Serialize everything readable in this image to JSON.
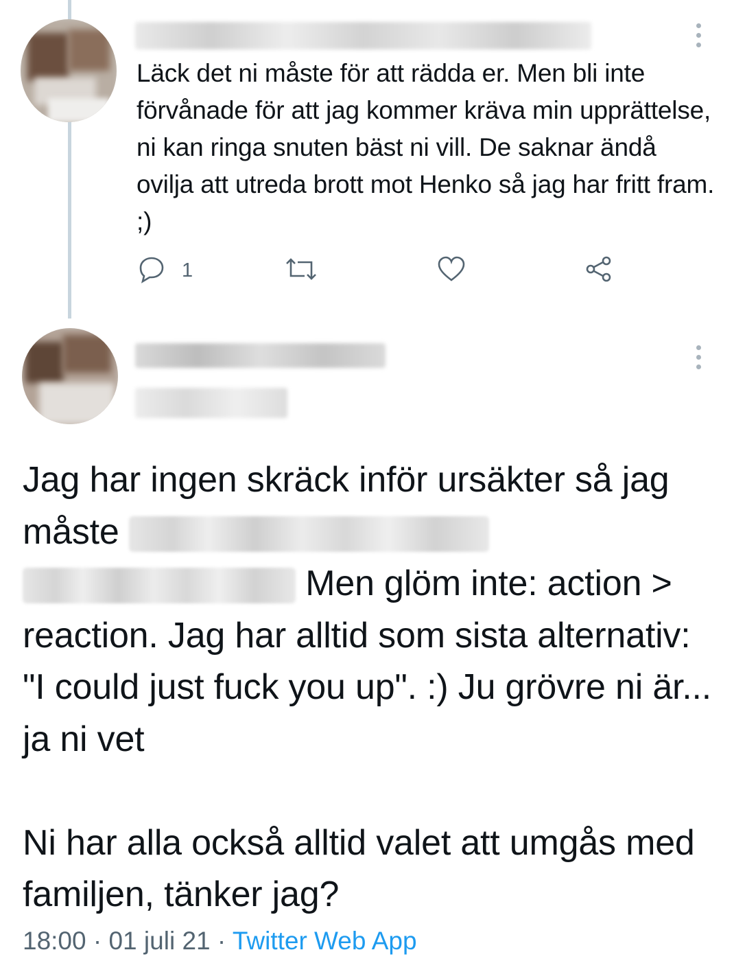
{
  "tweet1": {
    "text": "Läck det ni måste för att rädda er. Men bli inte förvånade för att jag kommer kräva min upprättelse, ni kan ringa snuten bäst ni vill. De saknar ändå ovilja att utreda brott mot Henko så jag har fritt fram. ;)",
    "reply_count": "1",
    "icons": {
      "reply": "reply-icon",
      "retweet": "retweet-icon",
      "like": "heart-icon",
      "share": "share-icon",
      "more": "more-vertical-icon"
    }
  },
  "tweet2": {
    "text_part1": "Jag har ingen skräck inför ursäkter så jag måste ",
    "text_part2": " Men glöm inte: action > reaction. Jag har alltid som sista alternativ: \"I could just fuck you up\". :) Ju grövre ni är... ja ni vet",
    "text_part3": "Ni har alla också alltid valet att umgås med familjen, tänker jag?",
    "time": "18:00",
    "separator": " · ",
    "date": "01 juli 21",
    "source": "Twitter Web App"
  },
  "colors": {
    "text": "#0f1419",
    "secondary": "#536471",
    "link": "#1d9bf0",
    "thread_line": "#c8d5de"
  }
}
